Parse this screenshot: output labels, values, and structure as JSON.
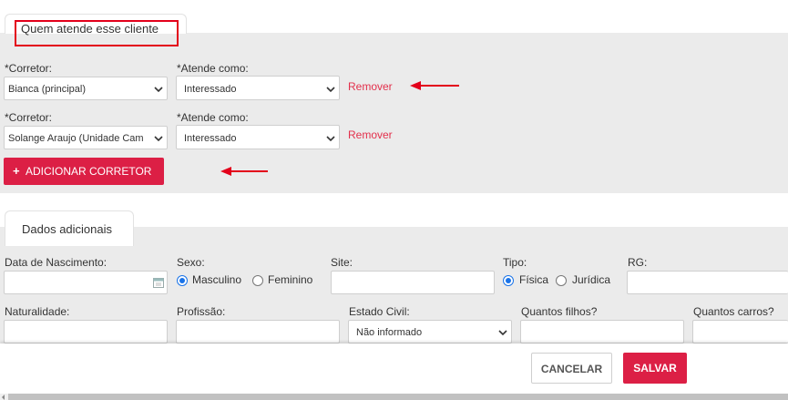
{
  "section_clients": {
    "title": "Quem atende esse cliente",
    "rows": [
      {
        "corretor_label": "*Corretor:",
        "corretor_value": "Bianca (principal)",
        "atende_label": "*Atende como:",
        "atende_value": "Interessado",
        "remove_label": "Remover"
      },
      {
        "corretor_label": "*Corretor:",
        "corretor_value": "Solange Araujo (Unidade Cam",
        "atende_label": "*Atende como:",
        "atende_value": "Interessado",
        "remove_label": "Remover"
      }
    ],
    "add_button_label": "ADICIONAR CORRETOR",
    "highlight_color": "#e3001b",
    "accent_color": "#dc1f45"
  },
  "section_additional": {
    "title": "Dados adicionais",
    "birth_label": "Data de Nascimento:",
    "sex_label": "Sexo:",
    "sex_options": [
      "Masculino",
      "Feminino"
    ],
    "sex_selected": "Masculino",
    "site_label": "Site:",
    "tipo_label": "Tipo:",
    "tipo_options": [
      "Física",
      "Jurídica"
    ],
    "tipo_selected": "Física",
    "rg_label": "RG:",
    "naturalidade_label": "Naturalidade:",
    "profissao_label": "Profissão:",
    "estado_civil_label": "Estado Civil:",
    "estado_civil_value": "Não informado",
    "filhos_label": "Quantos filhos?",
    "carros_label": "Quantos carros?"
  },
  "footer": {
    "cancel_label": "CANCELAR",
    "save_label": "SALVAR"
  }
}
